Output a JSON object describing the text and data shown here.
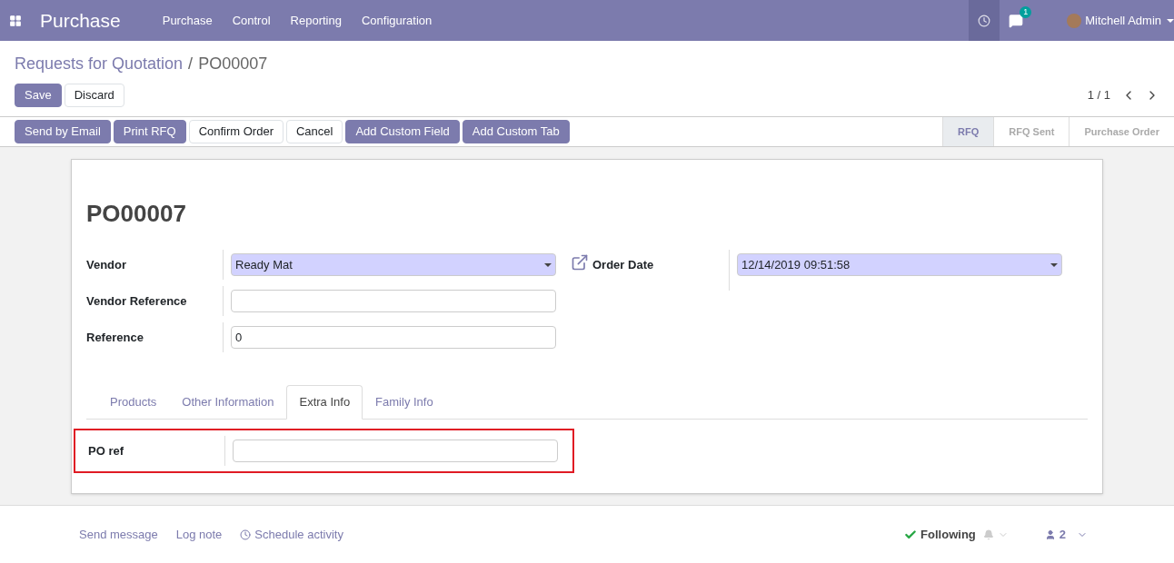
{
  "navbar": {
    "app_title": "Purchase",
    "menus": [
      "Purchase",
      "Control",
      "Reporting",
      "Configuration"
    ],
    "message_count": "1",
    "user_name": "Mitchell Admin"
  },
  "breadcrumb": [
    "Requests for Quotation",
    "/",
    "PO00007"
  ],
  "form_buttons": [
    {
      "label": "Save",
      "kind": "primary"
    },
    {
      "label": "Discard",
      "kind": "secondary"
    }
  ],
  "pager": "1 / 1",
  "header_buttons": [
    {
      "label": "Send by Email",
      "kind": "primary"
    },
    {
      "label": "Print RFQ",
      "kind": "primary"
    },
    {
      "label": "Confirm Order",
      "kind": "secondary"
    },
    {
      "label": "Cancel",
      "kind": "secondary"
    },
    {
      "label": "Add Custom Field",
      "kind": "primary"
    },
    {
      "label": "Add Custom Tab",
      "kind": "primary"
    }
  ],
  "stages": [
    {
      "label": "RFQ",
      "selected": true
    },
    {
      "label": "RFQ Sent",
      "selected": false
    },
    {
      "label": "Purchase Order",
      "selected": false
    }
  ],
  "sheet": {
    "title": "PO00007",
    "left_fields": [
      {
        "label": "Vendor",
        "value": "Ready Mat",
        "kind": "select",
        "required": true
      },
      {
        "label": "Vendor Reference",
        "kind": "text",
        "required": false
      },
      {
        "label": "Reference",
        "value": "0",
        "kind": "text",
        "required": false
      }
    ],
    "right_fields": [
      {
        "label": "Order Date",
        "value": "12/14/2019 09:51:58",
        "kind": "select",
        "required": true
      }
    ],
    "tabs": [
      {
        "label": "Products",
        "selected": false
      },
      {
        "label": "Other Information",
        "selected": false
      },
      {
        "label": "Extra Info",
        "selected": true
      },
      {
        "label": "Family Info",
        "selected": false
      }
    ],
    "tab_fields": [
      {
        "label": "PO ref",
        "kind": "text",
        "required": false,
        "highlighted": true
      }
    ]
  },
  "chatter": {
    "links": [
      "Send message",
      "Log note",
      "Schedule activity"
    ],
    "following": "Following",
    "followers": "2"
  }
}
